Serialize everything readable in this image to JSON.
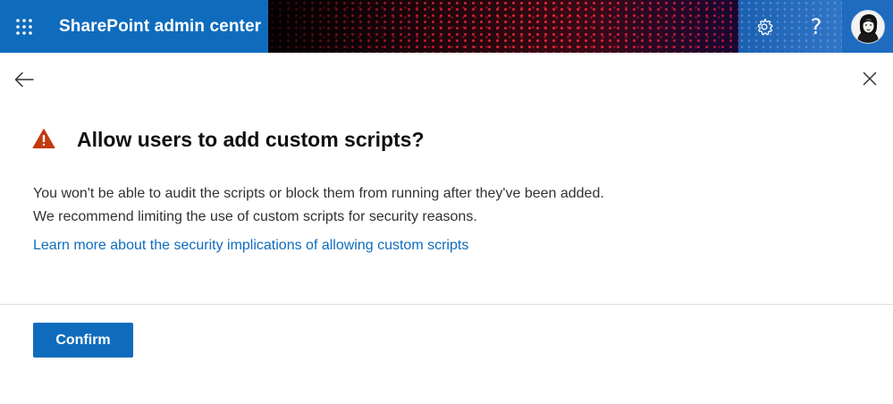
{
  "suite_bar": {
    "app_title": "SharePoint admin center",
    "app_launcher_icon": "waffle-grid-icon",
    "settings_icon": "gear-icon",
    "help_label": "?",
    "avatar_icon": "user-avatar"
  },
  "panel": {
    "back_icon": "arrow-left-icon",
    "close_icon": "close-icon",
    "warning_icon": "warning-triangle-icon",
    "title": "Allow users to add custom scripts?",
    "body_lines": [
      "You won't be able to audit the scripts or block them from running after they've been added.",
      "We recommend limiting the use of custom scripts for security reasons."
    ],
    "learn_more_link": "Learn more about the security implications of allowing custom scripts",
    "confirm_label": "Confirm"
  },
  "colors": {
    "brand_blue": "#0f6cbd",
    "warning_red": "#c23b0e",
    "title_text": "#111111",
    "body_text": "#323130",
    "divider": "#e1dfdd"
  }
}
